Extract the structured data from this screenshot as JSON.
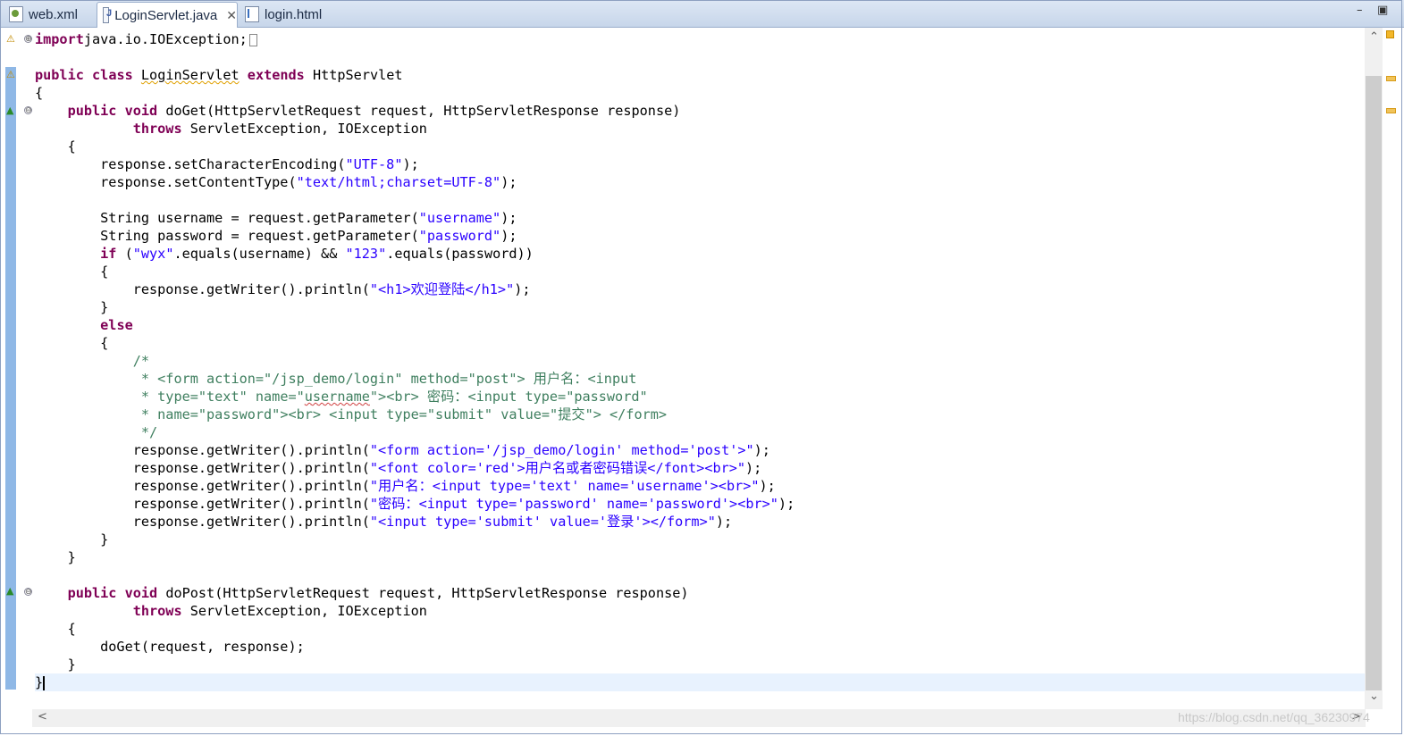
{
  "tabs": [
    {
      "label": "web.xml",
      "icon": "xml-file-icon",
      "active": false
    },
    {
      "label": "LoginServlet.java",
      "icon": "java-file-icon",
      "active": true
    },
    {
      "label": "login.html",
      "icon": "html-file-icon",
      "active": false
    }
  ],
  "tab_close": "✕",
  "window_controls": {
    "minimize": "–",
    "maximize": "▣"
  },
  "scroll": {
    "up": "⌃",
    "down": "⌄",
    "left": "<",
    "right": ">"
  },
  "fold": {
    "expanded": "⊖",
    "collapsed": "⊕"
  },
  "watermark": "https://blog.csdn.net/qq_36230974",
  "code_lines": [
    [
      [
        "kw",
        "import"
      ],
      [
        "",
        "java.io.IOException;"
      ]
    ],
    [],
    [
      [
        "kw",
        "public"
      ],
      [
        "",
        " "
      ],
      [
        "kw",
        "class"
      ],
      [
        "",
        " "
      ],
      [
        "squig",
        "LoginServlet"
      ],
      [
        "",
        " "
      ],
      [
        "kw",
        "extends"
      ],
      [
        "",
        " HttpServlet"
      ]
    ],
    [
      [
        "",
        "{"
      ]
    ],
    [
      [
        "",
        "    "
      ],
      [
        "kw",
        "public"
      ],
      [
        "",
        " "
      ],
      [
        "kw",
        "void"
      ],
      [
        "",
        " doGet(HttpServletRequest request, HttpServletResponse response)"
      ]
    ],
    [
      [
        "",
        "            "
      ],
      [
        "kw",
        "throws"
      ],
      [
        "",
        " ServletException, IOException"
      ]
    ],
    [
      [
        "",
        "    {"
      ]
    ],
    [
      [
        "",
        "        response.setCharacterEncoding("
      ],
      [
        "str",
        "\"UTF-8\""
      ],
      [
        "",
        ");"
      ]
    ],
    [
      [
        "",
        "        response.setContentType("
      ],
      [
        "str",
        "\"text/html;charset=UTF-8\""
      ],
      [
        "",
        ");"
      ]
    ],
    [],
    [
      [
        "",
        "        String username = request.getParameter("
      ],
      [
        "str",
        "\"username\""
      ],
      [
        "",
        ");"
      ]
    ],
    [
      [
        "",
        "        String password = request.getParameter("
      ],
      [
        "str",
        "\"password\""
      ],
      [
        "",
        ");"
      ]
    ],
    [
      [
        "",
        "        "
      ],
      [
        "kw",
        "if"
      ],
      [
        "",
        " ("
      ],
      [
        "str",
        "\"wyx\""
      ],
      [
        "",
        ".equals(username) && "
      ],
      [
        "str",
        "\"123\""
      ],
      [
        "",
        ".equals(password))"
      ]
    ],
    [
      [
        "",
        "        {"
      ]
    ],
    [
      [
        "",
        "            response.getWriter().println("
      ],
      [
        "str",
        "\"<h1>欢迎登陆</h1>\""
      ],
      [
        "",
        ");"
      ]
    ],
    [
      [
        "",
        "        }"
      ]
    ],
    [
      [
        "",
        "        "
      ],
      [
        "kw",
        "else"
      ]
    ],
    [
      [
        "",
        "        {"
      ]
    ],
    [
      [
        "",
        "            "
      ],
      [
        "cmt",
        "/*"
      ]
    ],
    [
      [
        "",
        "             "
      ],
      [
        "cmt",
        "* <form action=\"/jsp_demo/login\" method=\"post\"> 用户名：<input"
      ]
    ],
    [
      [
        "",
        "             "
      ],
      [
        "cmt",
        "* type=\"text\" name=\""
      ],
      [
        "cmt squigr",
        "username"
      ],
      [
        "cmt",
        "\"><br> 密码：<input type=\"password\""
      ]
    ],
    [
      [
        "",
        "             "
      ],
      [
        "cmt",
        "* name=\"password\"><br> <input type=\"submit\" value=\"提交\"> </form>"
      ]
    ],
    [
      [
        "",
        "             "
      ],
      [
        "cmt",
        "*/"
      ]
    ],
    [
      [
        "",
        "            response.getWriter().println("
      ],
      [
        "str",
        "\"<form action='/jsp_demo/login' method='post'>\""
      ],
      [
        "",
        ");"
      ]
    ],
    [
      [
        "",
        "            response.getWriter().println("
      ],
      [
        "str",
        "\"<font color='red'>用户名或者密码错误</font><br>\""
      ],
      [
        "",
        ");"
      ]
    ],
    [
      [
        "",
        "            response.getWriter().println("
      ],
      [
        "str",
        "\"用户名：<input type='text' name='username'><br>\""
      ],
      [
        "",
        ");"
      ]
    ],
    [
      [
        "",
        "            response.getWriter().println("
      ],
      [
        "str",
        "\"密码：<input type='password' name='password'><br>\""
      ],
      [
        "",
        ");"
      ]
    ],
    [
      [
        "",
        "            response.getWriter().println("
      ],
      [
        "str",
        "\"<input type='submit' value='登录'></form>\""
      ],
      [
        "",
        ");"
      ]
    ],
    [
      [
        "",
        "        }"
      ]
    ],
    [
      [
        "",
        "    }"
      ]
    ],
    [],
    [
      [
        "",
        "    "
      ],
      [
        "kw",
        "public"
      ],
      [
        "",
        " "
      ],
      [
        "kw",
        "void"
      ],
      [
        "",
        " doPost(HttpServletRequest request, HttpServletResponse response)"
      ]
    ],
    [
      [
        "",
        "            "
      ],
      [
        "kw",
        "throws"
      ],
      [
        "",
        " ServletException, IOException"
      ]
    ],
    [
      [
        "",
        "    {"
      ]
    ],
    [
      [
        "",
        "        doGet(request, response);"
      ]
    ],
    [
      [
        "",
        "    }"
      ]
    ],
    [
      [
        "",
        "}"
      ]
    ]
  ],
  "current_line": 36,
  "folded_import_line": 0,
  "colors": {
    "keyword": "#7f0055",
    "string": "#2a00ff",
    "comment": "#3f7f5f",
    "current_line": "#e8f2fe"
  }
}
